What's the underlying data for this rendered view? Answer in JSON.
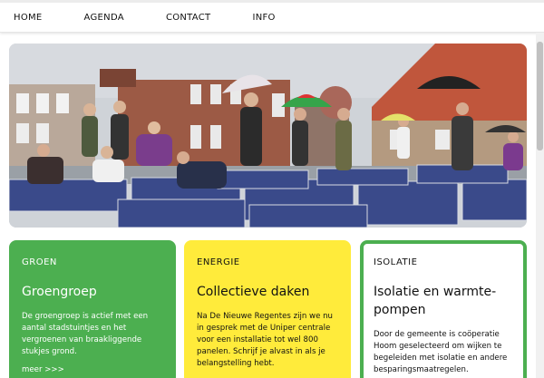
{
  "nav": {
    "items": [
      "HOME",
      "AGENDA",
      "CONTACT",
      "INFO"
    ]
  },
  "hero": {
    "image_alt": "People with umbrellas standing among solar panels on a rooftop"
  },
  "cards": [
    {
      "tag": "GROEN",
      "title": "Groengroep",
      "text": "De groengroep is actief met een aantal stadstuintjes en het vergroenen van braakliggende stukjes grond.",
      "more": "meer >>>",
      "color": "#4caf50"
    },
    {
      "tag": "ENERGIE",
      "title": "Collectieve daken",
      "text": "Na De Nieuwe Regentes zijn we nu in gesprek met de Uniper centrale voor een installatie tot wel 800 panelen. Schrijf je alvast in als je belangstelling hebt.",
      "color": "#ffeb3b"
    },
    {
      "tag": "ISOLATIE",
      "title": "Isolatie en warmte-pompen",
      "text": "Door de gemeente is coöperatie Hoom geselecteerd om wijken te begeleiden met isolatie en andere besparingsmaatregelen.",
      "color": "#4caf50"
    }
  ]
}
